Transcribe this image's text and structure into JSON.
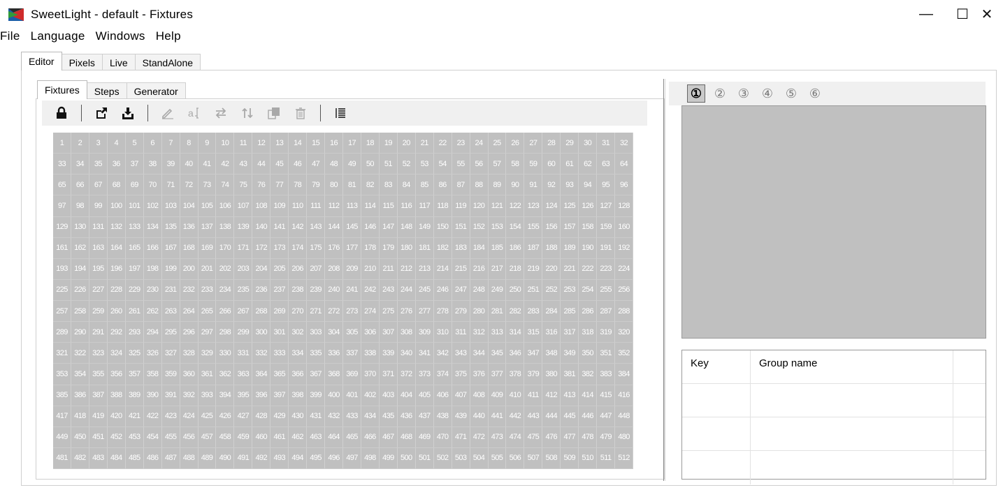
{
  "window": {
    "title": "SweetLight - default - Fixtures",
    "min_glyph": "—",
    "max_glyph": "☐",
    "close_glyph": "✕"
  },
  "menu": [
    "File",
    "Language",
    "Windows",
    "Help"
  ],
  "outer_tabs": [
    {
      "label": "Editor",
      "active": true
    },
    {
      "label": "Pixels",
      "active": false
    },
    {
      "label": "Live",
      "active": false
    },
    {
      "label": "StandAlone",
      "active": false
    }
  ],
  "inner_tabs": [
    {
      "label": "Fixtures",
      "active": true
    },
    {
      "label": "Steps",
      "active": false
    },
    {
      "label": "Generator",
      "active": false
    }
  ],
  "toolbar": [
    {
      "icon": "lock-icon",
      "enabled": true
    },
    {
      "sep": true
    },
    {
      "icon": "export-icon",
      "enabled": true
    },
    {
      "icon": "import-icon",
      "enabled": true
    },
    {
      "sep": true
    },
    {
      "icon": "pencil-icon",
      "enabled": false
    },
    {
      "icon": "rename-icon",
      "enabled": false
    },
    {
      "icon": "swap-icon",
      "enabled": false
    },
    {
      "icon": "sort-icon",
      "enabled": false
    },
    {
      "icon": "copy-icon",
      "enabled": false
    },
    {
      "icon": "trash-icon",
      "enabled": false
    },
    {
      "sep": true
    },
    {
      "icon": "list-icon",
      "enabled": true
    }
  ],
  "grid": {
    "count": 512,
    "columns": 32
  },
  "slots": [
    {
      "label": "①",
      "active": true
    },
    {
      "label": "②",
      "active": false
    },
    {
      "label": "③",
      "active": false
    },
    {
      "label": "④",
      "active": false
    },
    {
      "label": "⑤",
      "active": false
    },
    {
      "label": "⑥",
      "active": false
    }
  ],
  "group_table": {
    "headers": {
      "key": "Key",
      "name": "Group name"
    },
    "rows": [
      {
        "key": "",
        "name": ""
      },
      {
        "key": "",
        "name": ""
      },
      {
        "key": "",
        "name": ""
      }
    ]
  },
  "colors": {
    "grid_bg": "#c0c0c0",
    "cell_text": "#ffffff"
  }
}
